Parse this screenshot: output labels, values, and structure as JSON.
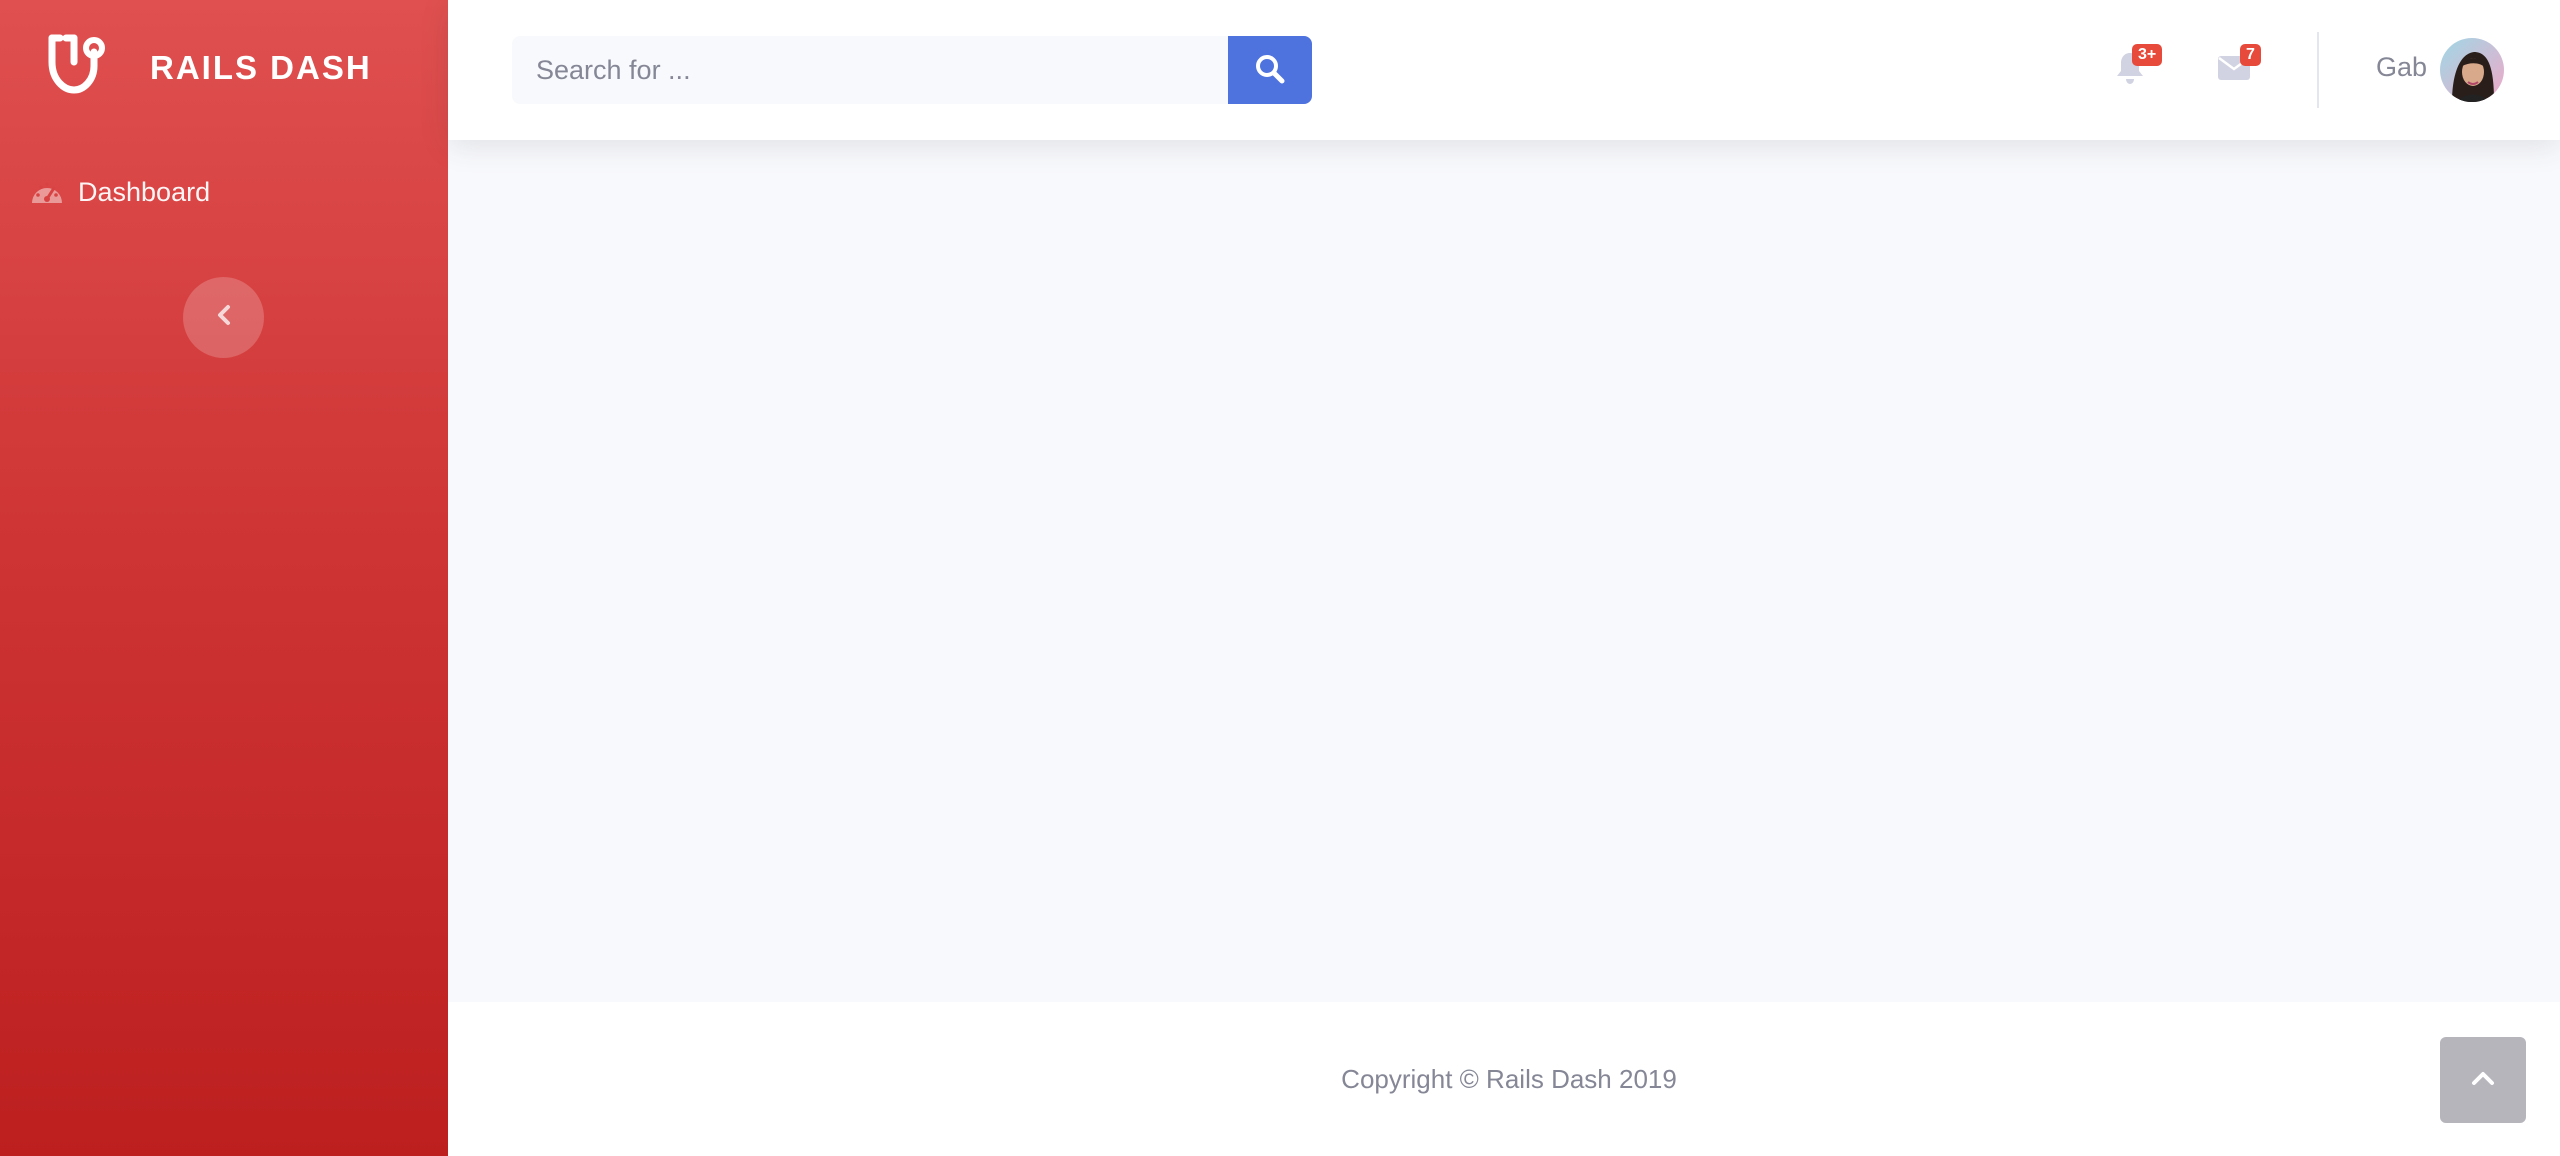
{
  "brand": {
    "name": "RAILS DASH",
    "icon": "stethoscope-icon"
  },
  "sidebar": {
    "items": [
      {
        "label": "Dashboard",
        "icon": "tachometer-icon"
      }
    ],
    "toggle_icon": "chevron-left-icon"
  },
  "topbar": {
    "search": {
      "placeholder": "Search for ...",
      "value": "",
      "button_icon": "search-icon"
    },
    "alerts": {
      "icon": "bell-icon",
      "badge": "3+"
    },
    "messages": {
      "icon": "envelope-icon",
      "badge": "7"
    },
    "user": {
      "name": "Gab",
      "avatar": "user-avatar"
    }
  },
  "footer": {
    "copyright": "Copyright © Rails Dash 2019"
  },
  "scroll_top": {
    "icon": "chevron-up-icon"
  },
  "colors": {
    "sidebar_gradient_top": "#e05050",
    "sidebar_gradient_bottom": "#bd1f1f",
    "primary": "#4e73df",
    "badge": "#e74a3b",
    "page_bg": "#f8f9fc",
    "muted_text": "#858796"
  }
}
